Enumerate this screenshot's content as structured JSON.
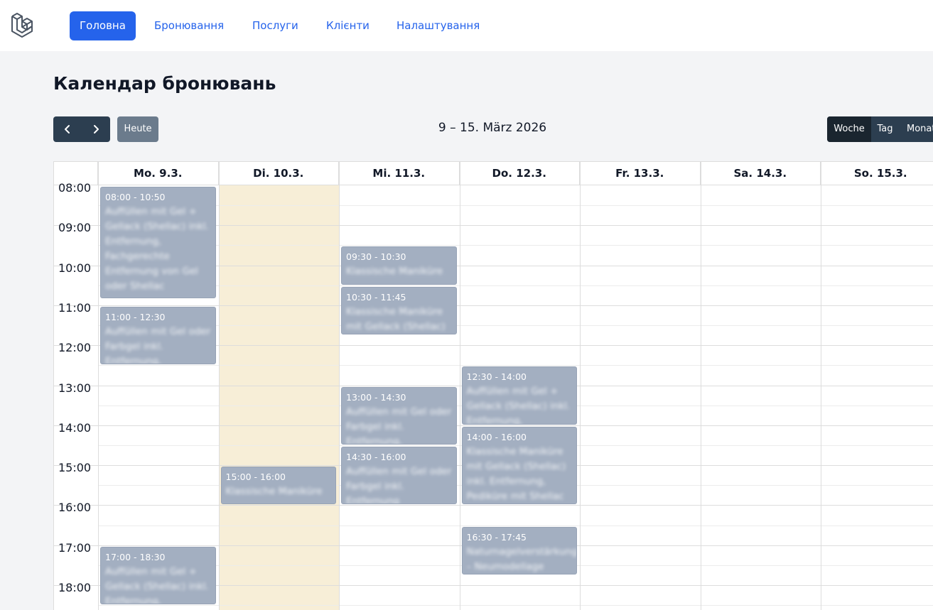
{
  "nav": {
    "items": [
      {
        "label": "Головна",
        "active": true
      },
      {
        "label": "Бронювання",
        "active": false
      },
      {
        "label": "Послуги",
        "active": false
      },
      {
        "label": "Клієнти",
        "active": false
      },
      {
        "label": "Налаштування",
        "active": false
      }
    ]
  },
  "page": {
    "title": "Календар бронювань"
  },
  "toolbar": {
    "prev_icon": "chevron-left-icon",
    "next_icon": "chevron-right-icon",
    "today_label": "Heute",
    "range_title": "9 – 15. März 2026",
    "views": [
      {
        "label": "Woche",
        "active": true
      },
      {
        "label": "Tag",
        "active": false
      },
      {
        "label": "Monat",
        "active": false
      }
    ]
  },
  "calendar": {
    "days": [
      "Mo. 9.3.",
      "Di. 10.3.",
      "Mi. 11.3.",
      "Do. 12.3.",
      "Fr. 13.3.",
      "Sa. 14.3.",
      "So. 15.3."
    ],
    "today_index": 1,
    "hours": [
      "08:00",
      "09:00",
      "10:00",
      "11:00",
      "12:00",
      "13:00",
      "14:00",
      "15:00",
      "16:00",
      "17:00",
      "18:00"
    ],
    "events": [
      {
        "day": 0,
        "time": "08:00 - 10:50",
        "title": "Auffüllen mit Gel + Gellack (Shellac) inkl. Entfernung, Fachgerechte Entfernung von Gel oder Shellac"
      },
      {
        "day": 0,
        "time": "11:00 - 12:30",
        "title": "Auffüllen mit Gel oder Farbgel inkl. Entfernung, klassische"
      },
      {
        "day": 0,
        "time": "17:00 - 18:30",
        "title": "Auffüllen mit Gel + Gellack (Shellac) inkl. Entfernung, klassische"
      },
      {
        "day": 1,
        "time": "15:00 - 16:00",
        "title": "Klassische Maniküre"
      },
      {
        "day": 2,
        "time": "09:30 - 10:30",
        "title": "Klassische Maniküre"
      },
      {
        "day": 2,
        "time": "10:30 - 11:45",
        "title": "Klassische Maniküre mit Gellack (Shellac)"
      },
      {
        "day": 2,
        "time": "13:00 - 14:30",
        "title": "Auffüllen mit Gel oder Farbgel inkl. Entfernung, klassische"
      },
      {
        "day": 2,
        "time": "14:30 - 16:00",
        "title": "Auffüllen mit Gel oder Farbgel inkl. Entfernung"
      },
      {
        "day": 3,
        "time": "12:30 - 14:00",
        "title": "Auffüllen mit Gel + Gellack (Shellac) inkl. Entfernung, klassische"
      },
      {
        "day": 3,
        "time": "14:00 - 16:00",
        "title": "Klassische Maniküre mit Gellack (Shellac) inkl. Entfernung, Pediküre mit Shellac"
      },
      {
        "day": 3,
        "time": "16:30 - 17:45",
        "title": "Naturnagelverstärkung – Neumodellage"
      }
    ]
  },
  "colors": {
    "primary": "#2563eb",
    "toolbar_dark": "#2c3e50",
    "today_bg": "#f7eed7",
    "event_bg": "#a3afc1"
  }
}
